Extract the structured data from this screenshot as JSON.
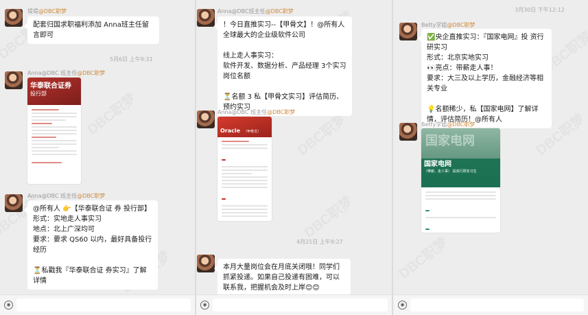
{
  "col1": {
    "top_sender": "堤堤",
    "top_sender_tag": "@DBC职梦",
    "top_message": "配套归国求职福利添加 Anna班主任留言即可",
    "time1": "5月6日 上午9:31",
    "msg2_sender": "Anna@DBC 班主任",
    "msg2_tag": "@DBC职梦",
    "poster1_title": "华泰联合证券",
    "poster1_subtitle": "投行部",
    "msg3_sender": "Anna@DBC 班主任",
    "msg3_tag": "@DBC职梦",
    "msg3_text": "@所有人 👉【华泰联合证 券 投行部】\n形式：实地走人事实习\n地点：北上广深均可\n要求：要求 QS60 以内，最好具备投行经历\n\n⏳私戳我『华泰联合证 券实习』了解详情"
  },
  "col2": {
    "top_sender": "Anna@DBC班主任",
    "top_sender_tag": "@DBC职梦",
    "top_message": "！今日直推实习--【甲骨文】！@所有人\n全球最大的企业级软件公司\n\n线上走人事实习：\n软件开发、数据分析、产品经理 3个实习岗位名额\n\n⏳名额 3 私【甲骨文实习】评估简历、预约实习",
    "msg2_sender": "Anna@DBC 班主任",
    "msg2_tag": "@DBC职梦",
    "poster2_title": "Oracle",
    "poster2_sub": "（甲骨文）",
    "time1": "4月21日 上午9:27",
    "msg3_text": "本月大量岗位会在月底关闭哦！同学们抓紧投递。如果自己投递有困难，可以联系我，把握机会及时上岸😊😊"
  },
  "col3": {
    "time1": "3月30日 下午12:12",
    "msg1_sender": "Betty学姐",
    "msg1_tag": "@DBC职梦",
    "msg1_text": "✅央企直推实习：『国家电网』投 资行研实习\n形式：北京实地实习\n👀亮点：带薪走人事！\n要求：大三及以上学历，金融经济等相关专业\n\n💡名额稀少，私【国家电网】了解详情，评估简历！@所有人",
    "msg2_sender": "Betty学姐",
    "msg2_tag": "@DBC职梦",
    "poster3_title": "国家电网",
    "poster3_sub": "（带薪、走人事）",
    "poster3_role": "投资行研实习生"
  },
  "watermark": "DBC职梦",
  "colors": {
    "bubble": "#ffffff",
    "bg": "#ededed",
    "poster_red": "#b2302a",
    "poster_green": "#2e7d5b"
  }
}
